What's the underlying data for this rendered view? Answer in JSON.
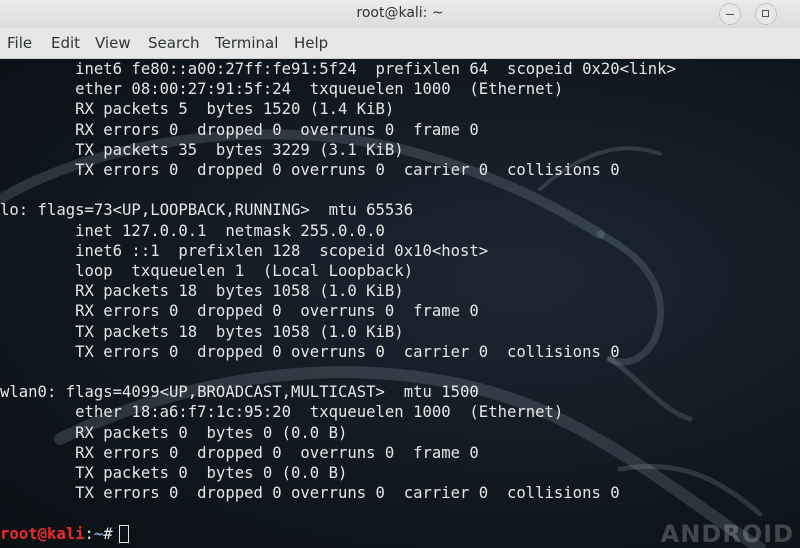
{
  "window": {
    "title": "root@kali: ~",
    "minimize_glyph": "−",
    "maximize_glyph": "□"
  },
  "menu": {
    "items": [
      "File",
      "Edit",
      "View",
      "Search",
      "Terminal",
      "Help"
    ]
  },
  "terminal": {
    "lines": [
      "        inet6 fe80::a00:27ff:fe91:5f24  prefixlen 64  scopeid 0x20<link>",
      "        ether 08:00:27:91:5f:24  txqueuelen 1000  (Ethernet)",
      "        RX packets 5  bytes 1520 (1.4 KiB)",
      "        RX errors 0  dropped 0  overruns 0  frame 0",
      "        TX packets 35  bytes 3229 (3.1 KiB)",
      "        TX errors 0  dropped 0 overruns 0  carrier 0  collisions 0",
      "",
      "lo: flags=73<UP,LOOPBACK,RUNNING>  mtu 65536",
      "        inet 127.0.0.1  netmask 255.0.0.0",
      "        inet6 ::1  prefixlen 128  scopeid 0x10<host>",
      "        loop  txqueuelen 1  (Local Loopback)",
      "        RX packets 18  bytes 1058 (1.0 KiB)",
      "        RX errors 0  dropped 0  overruns 0  frame 0",
      "        TX packets 18  bytes 1058 (1.0 KiB)",
      "        TX errors 0  dropped 0 overruns 0  carrier 0  collisions 0",
      "",
      "wlan0: flags=4099<UP,BROADCAST,MULTICAST>  mtu 1500",
      "        ether 18:a6:f7:1c:95:20  txqueuelen 1000  (Ethernet)",
      "        RX packets 0  bytes 0 (0.0 B)",
      "        RX errors 0  dropped 0  overruns 0  frame 0",
      "        TX packets 0  bytes 0 (0.0 B)",
      "        TX errors 0  dropped 0 overruns 0  carrier 0  collisions 0",
      ""
    ],
    "prompt": {
      "user": "root@kali",
      "separator": ":",
      "path": "~",
      "symbol": "#"
    },
    "colors": {
      "prompt_user": "#ef2929",
      "prompt_path": "#729fcf",
      "text": "#e6e6e6"
    }
  },
  "watermark": "ANDROID"
}
